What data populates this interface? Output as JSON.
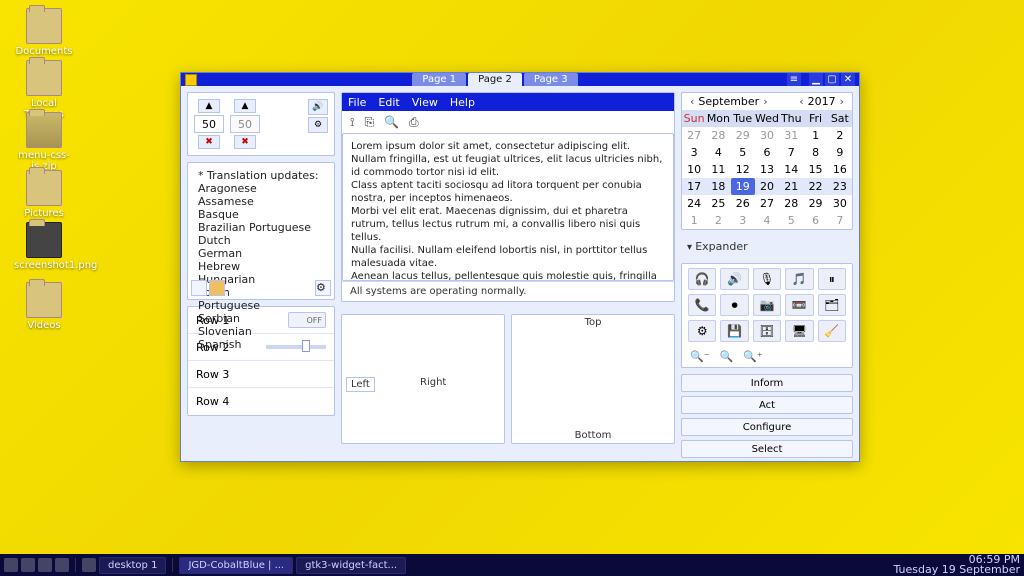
{
  "desktop": {
    "icons": [
      "Documents",
      "Local Themes",
      "menu-css-js.zip",
      "Pictures",
      "screenshot1.png",
      "Videos"
    ]
  },
  "taskbar": {
    "workspace": "desktop 1",
    "tasks": [
      "JGD-CobaltBlue | ...",
      "gtk3-widget-fact..."
    ],
    "time": "06:59 PM",
    "date": "Tuesday 19 September"
  },
  "window": {
    "tabs": [
      "Page 1",
      "Page 2",
      "Page 3"
    ],
    "active_tab": 1,
    "spinners": {
      "val1": "50",
      "val2": "50"
    },
    "languages": {
      "heading": "* Translation updates:",
      "items": [
        "Aragonese",
        "Assamese",
        "Basque",
        "Brazilian Portuguese",
        "Dutch",
        "German",
        "Hebrew",
        "Hungarian",
        "Polish",
        "Portuguese",
        "Serbian",
        "Slovenian",
        "Spanish"
      ]
    },
    "rows": [
      "Row 1",
      "Row 2",
      "Row 3",
      "Row 4"
    ],
    "switch_label": "OFF",
    "menu": [
      "File",
      "Edit",
      "View",
      "Help"
    ],
    "lorem": "Lorem ipsum dolor sit amet, consectetur adipiscing elit.\nNullam fringilla, est ut feugiat ultrices, elit lacus ultricies nibh, id commodo tortor nisi id elit.\nClass aptent taciti sociosqu ad litora torquent per conubia nostra, per inceptos himenaeos.\nMorbi vel elit erat. Maecenas dignissim, dui et pharetra rutrum, tellus lectus rutrum mi, a convallis libero nisi quis tellus.\nNulla facilisi. Nullam eleifend lobortis nisl, in porttitor tellus malesuada vitae.\nAenean lacus tellus, pellentesque quis molestie quis, fringilla in arcu.\nDuis elementum, tellus sed tristique semper, metus metus accumsan augue, et porttitor augue orci a libero.\nUt sed justo ac felis placerat laoreet sed id sem. Proin mattis tincidunt odio vitae tristique.\nMorbi massa libero, congue vitae scelerisque vel, ultricies vel nisl.\nVestibulum in tortor diam, quis aliquet quam. Praesent ut justo neque, tempus rutrum est.",
    "status": "All systems are operating normally.",
    "frames": {
      "left": "Left",
      "right": "Right",
      "top": "Top",
      "bottom": "Bottom"
    },
    "calendar": {
      "month": "September",
      "year": "2017",
      "days": [
        "Sun",
        "Mon",
        "Tue",
        "Wed",
        "Thu",
        "Fri",
        "Sat"
      ],
      "weeks": [
        [
          {
            "d": 27,
            "o": 1
          },
          {
            "d": 28,
            "o": 1
          },
          {
            "d": 29,
            "o": 1
          },
          {
            "d": 30,
            "o": 1
          },
          {
            "d": 31,
            "o": 1
          },
          {
            "d": 1
          },
          {
            "d": 2
          }
        ],
        [
          {
            "d": 3
          },
          {
            "d": 4
          },
          {
            "d": 5
          },
          {
            "d": 6
          },
          {
            "d": 7
          },
          {
            "d": 8
          },
          {
            "d": 9
          }
        ],
        [
          {
            "d": 10
          },
          {
            "d": 11
          },
          {
            "d": 12
          },
          {
            "d": 13
          },
          {
            "d": 14
          },
          {
            "d": 15
          },
          {
            "d": 16
          }
        ],
        [
          {
            "d": 17
          },
          {
            "d": 18
          },
          {
            "d": 19,
            "t": 1
          },
          {
            "d": 20
          },
          {
            "d": 21
          },
          {
            "d": 22
          },
          {
            "d": 23
          }
        ],
        [
          {
            "d": 24
          },
          {
            "d": 25
          },
          {
            "d": 26
          },
          {
            "d": 27
          },
          {
            "d": 28
          },
          {
            "d": 29
          },
          {
            "d": 30
          }
        ],
        [
          {
            "d": 1,
            "o": 1
          },
          {
            "d": 2,
            "o": 1
          },
          {
            "d": 3,
            "o": 1
          },
          {
            "d": 4,
            "o": 1
          },
          {
            "d": 5,
            "o": 1
          },
          {
            "d": 6,
            "o": 1
          },
          {
            "d": 7,
            "o": 1
          }
        ]
      ]
    },
    "expander": "Expander",
    "icon_grid": [
      "🎧",
      "🔊",
      "🎙",
      "🎵",
      "⏸",
      "📞",
      "⏺",
      "📷",
      "📼",
      "🗂",
      "⚙",
      "💾",
      "🗄",
      "🖥",
      "🧹"
    ],
    "actions": [
      "Inform",
      "Act",
      "Configure",
      "Select"
    ]
  }
}
